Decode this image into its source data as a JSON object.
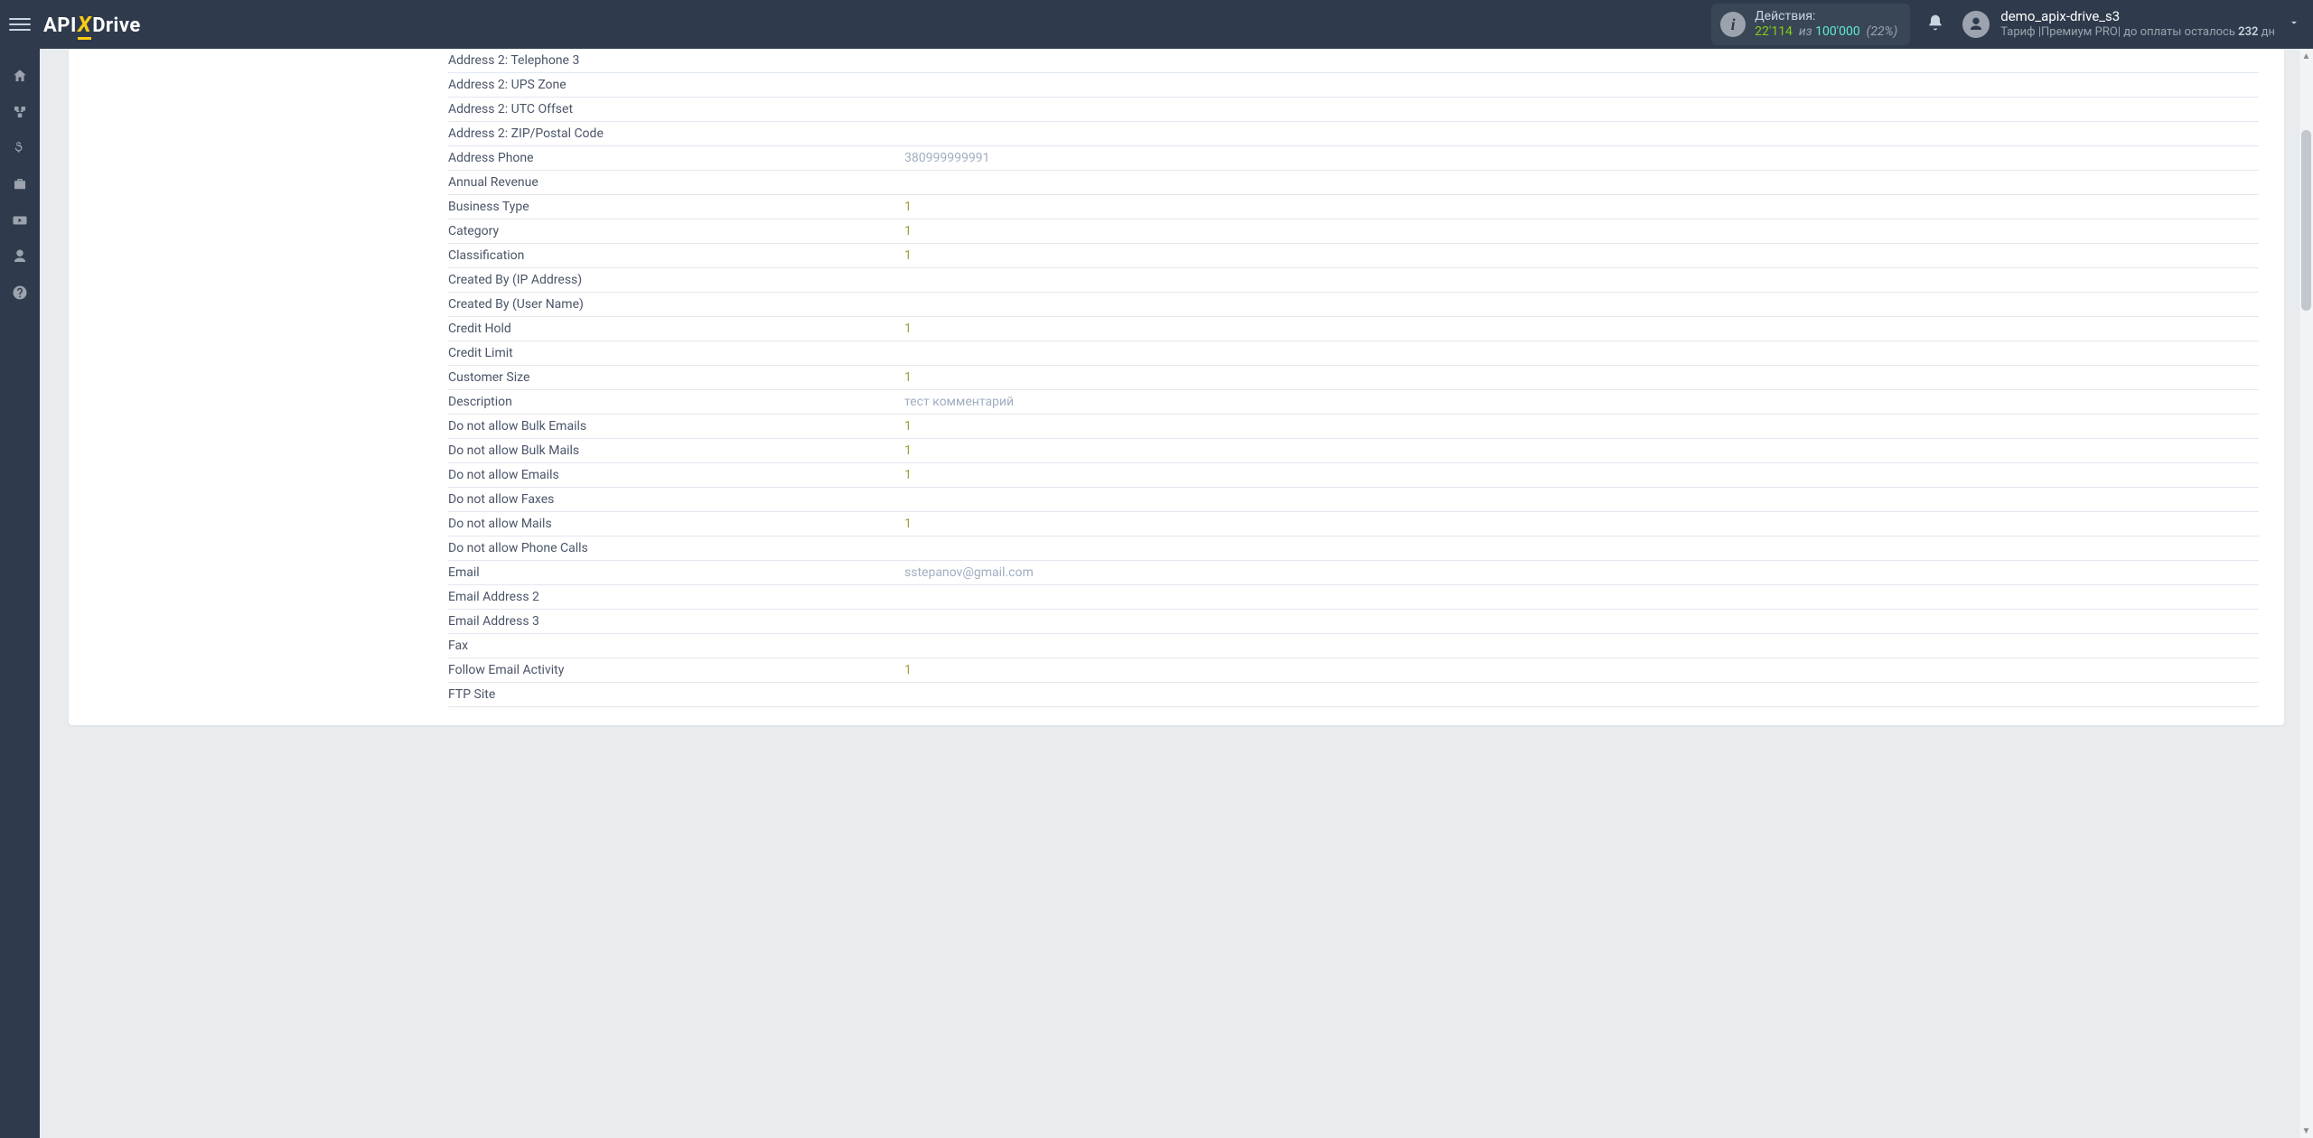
{
  "header": {
    "logo_api": "API",
    "logo_x": "X",
    "logo_drive": "Drive",
    "actions_label": "Действия:",
    "actions_used": "22'114",
    "actions_of_word": "из",
    "actions_total": "100'000",
    "actions_percent": "(22%)",
    "username": "demo_apix-drive_s3",
    "tariff_prefix": "Тариф |",
    "tariff_name": "Премиум PRO",
    "tariff_mid": "|  до оплаты осталось ",
    "tariff_days": "232",
    "tariff_suffix": " дн"
  },
  "fields": [
    {
      "label": "Address 2: Telephone 3",
      "value": "",
      "cls": ""
    },
    {
      "label": "Address 2: UPS Zone",
      "value": "",
      "cls": ""
    },
    {
      "label": "Address 2: UTC Offset",
      "value": "",
      "cls": ""
    },
    {
      "label": "Address 2: ZIP/Postal Code",
      "value": "",
      "cls": ""
    },
    {
      "label": "Address Phone",
      "value": "380999999991",
      "cls": "val-gray"
    },
    {
      "label": "Annual Revenue",
      "value": "",
      "cls": ""
    },
    {
      "label": "Business Type",
      "value": "1",
      "cls": "val-olive"
    },
    {
      "label": "Category",
      "value": "1",
      "cls": "val-olive"
    },
    {
      "label": "Classification",
      "value": "1",
      "cls": "val-olive"
    },
    {
      "label": "Created By (IP Address)",
      "value": "",
      "cls": ""
    },
    {
      "label": "Created By (User Name)",
      "value": "",
      "cls": ""
    },
    {
      "label": "Credit Hold",
      "value": "1",
      "cls": "val-olive"
    },
    {
      "label": "Credit Limit",
      "value": "",
      "cls": ""
    },
    {
      "label": "Customer Size",
      "value": "1",
      "cls": "val-olive"
    },
    {
      "label": "Description",
      "value": "тест комментарий",
      "cls": "val-gray"
    },
    {
      "label": "Do not allow Bulk Emails",
      "value": "1",
      "cls": "val-olive"
    },
    {
      "label": "Do not allow Bulk Mails",
      "value": "1",
      "cls": "val-olive"
    },
    {
      "label": "Do not allow Emails",
      "value": "1",
      "cls": "val-olive"
    },
    {
      "label": "Do not allow Faxes",
      "value": "",
      "cls": ""
    },
    {
      "label": "Do not allow Mails",
      "value": "1",
      "cls": "val-olive"
    },
    {
      "label": "Do not allow Phone Calls",
      "value": "",
      "cls": ""
    },
    {
      "label": "Email",
      "value": "sstepanov@gmail.com",
      "cls": "val-gray"
    },
    {
      "label": "Email Address 2",
      "value": "",
      "cls": ""
    },
    {
      "label": "Email Address 3",
      "value": "",
      "cls": ""
    },
    {
      "label": "Fax",
      "value": "",
      "cls": ""
    },
    {
      "label": "Follow Email Activity",
      "value": "1",
      "cls": "val-olive"
    },
    {
      "label": "FTP Site",
      "value": "",
      "cls": ""
    }
  ]
}
